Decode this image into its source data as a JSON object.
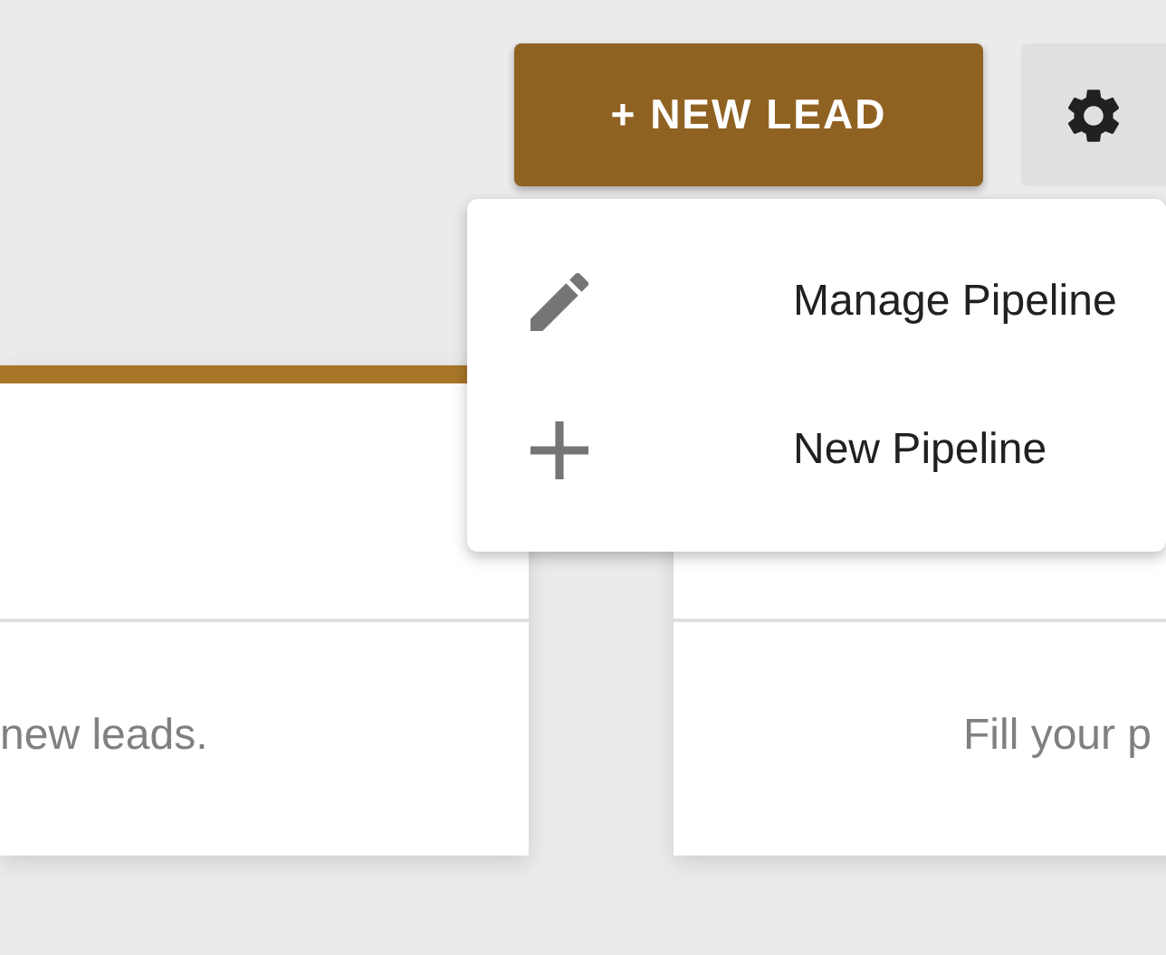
{
  "header": {
    "new_lead_button": "+ NEW LEAD"
  },
  "menu": {
    "items": [
      {
        "kind": "edit",
        "label": "Manage Pipeline"
      },
      {
        "kind": "add",
        "label": "New Pipeline"
      }
    ]
  },
  "columns": [
    {
      "hint": "new leads."
    },
    {
      "hint": "Fill your p"
    }
  ]
}
